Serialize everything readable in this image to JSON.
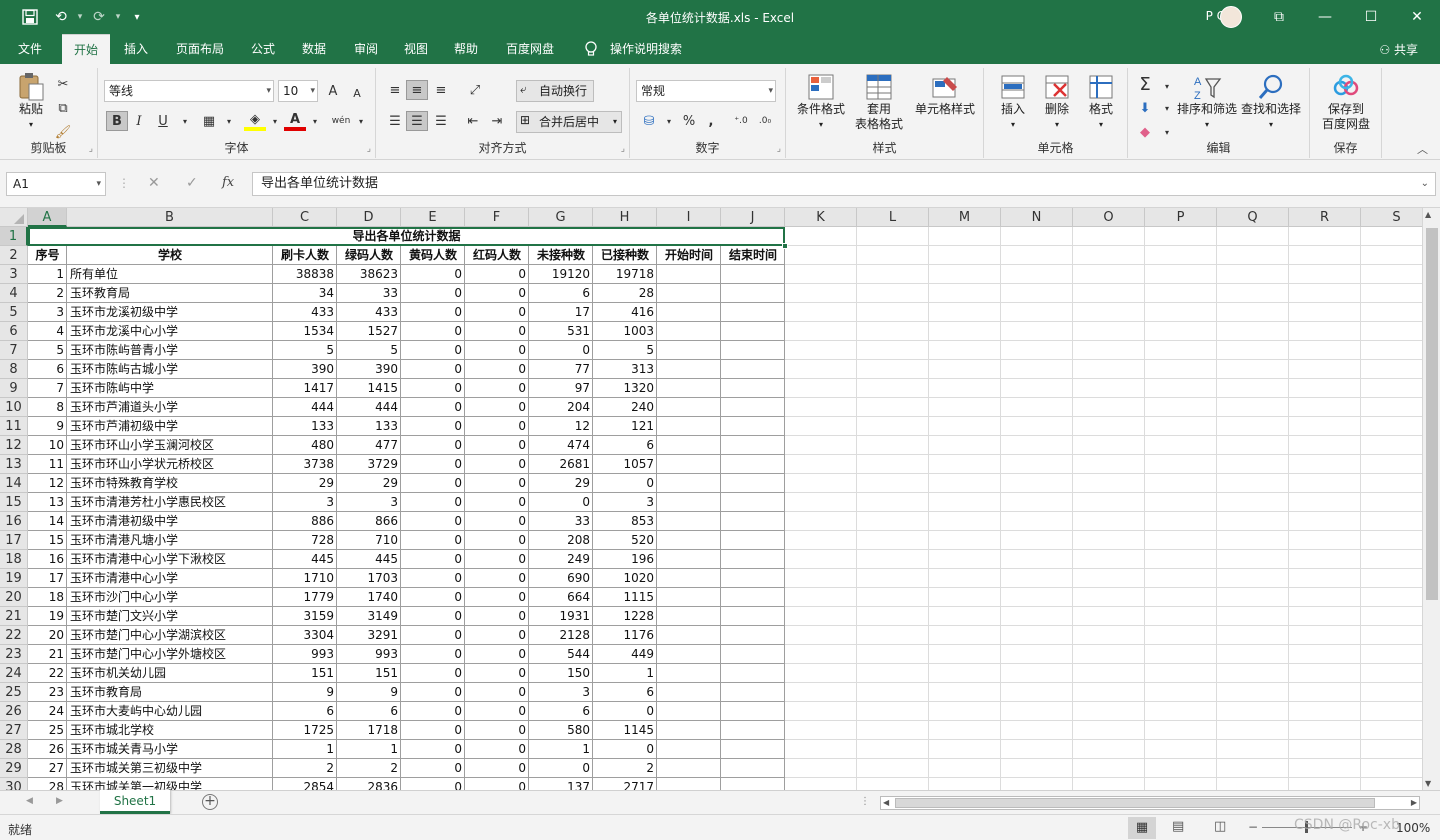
{
  "titlebar": {
    "title": "各单位统计数据.xls  -  Excel",
    "user": "P C",
    "save_icon": "save-icon",
    "undo_icon": "undo-icon",
    "redo_icon": "redo-icon",
    "customize": "▾",
    "btn_ribbon_display": "⧉",
    "btn_min": "—",
    "btn_max": "☐",
    "btn_close": "✕"
  },
  "tabs": [
    "文件",
    "开始",
    "插入",
    "页面布局",
    "公式",
    "数据",
    "审阅",
    "视图",
    "帮助",
    "百度网盘",
    "操作说明搜索"
  ],
  "active_tab": "开始",
  "share_label": "共享",
  "ribbon": {
    "clipboard": {
      "paste": "粘贴",
      "label": "剪贴板"
    },
    "font": {
      "name": "等线",
      "size": "10",
      "label": "字体",
      "bold": "B",
      "italic": "I",
      "underline": "U",
      "grow": "A",
      "shrink": "A",
      "phonetic": "wén"
    },
    "alignment": {
      "wrap": "自动换行",
      "merge": "合并后居中",
      "label": "对齐方式"
    },
    "number": {
      "format": "常规",
      "label": "数字",
      "percent": "%",
      "comma": ","
    },
    "styles": {
      "cond": "条件格式",
      "table1": "套用",
      "table2": "表格格式",
      "cell": "单元格样式",
      "label": "样式"
    },
    "cells": {
      "insert": "插入",
      "delete": "删除",
      "format": "格式",
      "label": "单元格"
    },
    "editing": {
      "sort": "排序和筛选",
      "find": "查找和选择",
      "label": "编辑"
    },
    "save": {
      "save1": "保存到",
      "save2": "百度网盘",
      "label": "保存"
    }
  },
  "formula": {
    "namebox": "A1",
    "content": "导出各单位统计数据",
    "fx": "fx",
    "cancel": "✕",
    "enter": "✓"
  },
  "columns": [
    "A",
    "B",
    "C",
    "D",
    "E",
    "F",
    "G",
    "H",
    "I",
    "J",
    "K",
    "L",
    "M",
    "N",
    "O",
    "P",
    "Q",
    "R",
    "S"
  ],
  "sheet": {
    "title": "导出各单位统计数据",
    "headers": [
      "序号",
      "学校",
      "刷卡人数",
      "绿码人数",
      "黄码人数",
      "红码人数",
      "未接种数",
      "已接种数",
      "开始时间",
      "结束时间"
    ],
    "rows": [
      [
        "1",
        "所有单位",
        "38838",
        "38623",
        "0",
        "0",
        "19120",
        "19718"
      ],
      [
        "2",
        "玉环教育局",
        "34",
        "33",
        "0",
        "0",
        "6",
        "28"
      ],
      [
        "3",
        "玉环市龙溪初级中学",
        "433",
        "433",
        "0",
        "0",
        "17",
        "416"
      ],
      [
        "4",
        "玉环市龙溪中心小学",
        "1534",
        "1527",
        "0",
        "0",
        "531",
        "1003"
      ],
      [
        "5",
        "玉环市陈屿普青小学",
        "5",
        "5",
        "0",
        "0",
        "0",
        "5"
      ],
      [
        "6",
        "玉环市陈屿古城小学",
        "390",
        "390",
        "0",
        "0",
        "77",
        "313"
      ],
      [
        "7",
        "玉环市陈屿中学",
        "1417",
        "1415",
        "0",
        "0",
        "97",
        "1320"
      ],
      [
        "8",
        "玉环市芦浦道头小学",
        "444",
        "444",
        "0",
        "0",
        "204",
        "240"
      ],
      [
        "9",
        "玉环市芦浦初级中学",
        "133",
        "133",
        "0",
        "0",
        "12",
        "121"
      ],
      [
        "10",
        "玉环市环山小学玉澜河校区",
        "480",
        "477",
        "0",
        "0",
        "474",
        "6"
      ],
      [
        "11",
        "玉环市环山小学状元桥校区",
        "3738",
        "3729",
        "0",
        "0",
        "2681",
        "1057"
      ],
      [
        "12",
        "玉环市特殊教育学校",
        "29",
        "29",
        "0",
        "0",
        "29",
        "0"
      ],
      [
        "13",
        "玉环市清港芳杜小学惠民校区",
        "3",
        "3",
        "0",
        "0",
        "0",
        "3"
      ],
      [
        "14",
        "玉环市清港初级中学",
        "886",
        "866",
        "0",
        "0",
        "33",
        "853"
      ],
      [
        "15",
        "玉环市清港凡塘小学",
        "728",
        "710",
        "0",
        "0",
        "208",
        "520"
      ],
      [
        "16",
        "玉环市清港中心小学下湫校区",
        "445",
        "445",
        "0",
        "0",
        "249",
        "196"
      ],
      [
        "17",
        "玉环市清港中心小学",
        "1710",
        "1703",
        "0",
        "0",
        "690",
        "1020"
      ],
      [
        "18",
        "玉环市沙门中心小学",
        "1779",
        "1740",
        "0",
        "0",
        "664",
        "1115"
      ],
      [
        "19",
        "玉环市楚门文兴小学",
        "3159",
        "3149",
        "0",
        "0",
        "1931",
        "1228"
      ],
      [
        "20",
        "玉环市楚门中心小学湖滨校区",
        "3304",
        "3291",
        "0",
        "0",
        "2128",
        "1176"
      ],
      [
        "21",
        "玉环市楚门中心小学外塘校区",
        "993",
        "993",
        "0",
        "0",
        "544",
        "449"
      ],
      [
        "22",
        "玉环市机关幼儿园",
        "151",
        "151",
        "0",
        "0",
        "150",
        "1"
      ],
      [
        "23",
        "玉环市教育局",
        "9",
        "9",
        "0",
        "0",
        "3",
        "6"
      ],
      [
        "24",
        "玉环市大麦屿中心幼儿园",
        "6",
        "6",
        "0",
        "0",
        "6",
        "0"
      ],
      [
        "25",
        "玉环市城北学校",
        "1725",
        "1718",
        "0",
        "0",
        "580",
        "1145"
      ],
      [
        "26",
        "玉环市城关青马小学",
        "1",
        "1",
        "0",
        "0",
        "1",
        "0"
      ],
      [
        "27",
        "玉环市城关第三初级中学",
        "2",
        "2",
        "0",
        "0",
        "0",
        "2"
      ],
      [
        "28",
        "玉环市城关第一初级中学",
        "2854",
        "2836",
        "0",
        "0",
        "137",
        "2717"
      ]
    ]
  },
  "sheet_tab": "Sheet1",
  "status": {
    "ready": "就绪",
    "zoom": "100%"
  },
  "watermark": "CSDN @Roc-xb"
}
